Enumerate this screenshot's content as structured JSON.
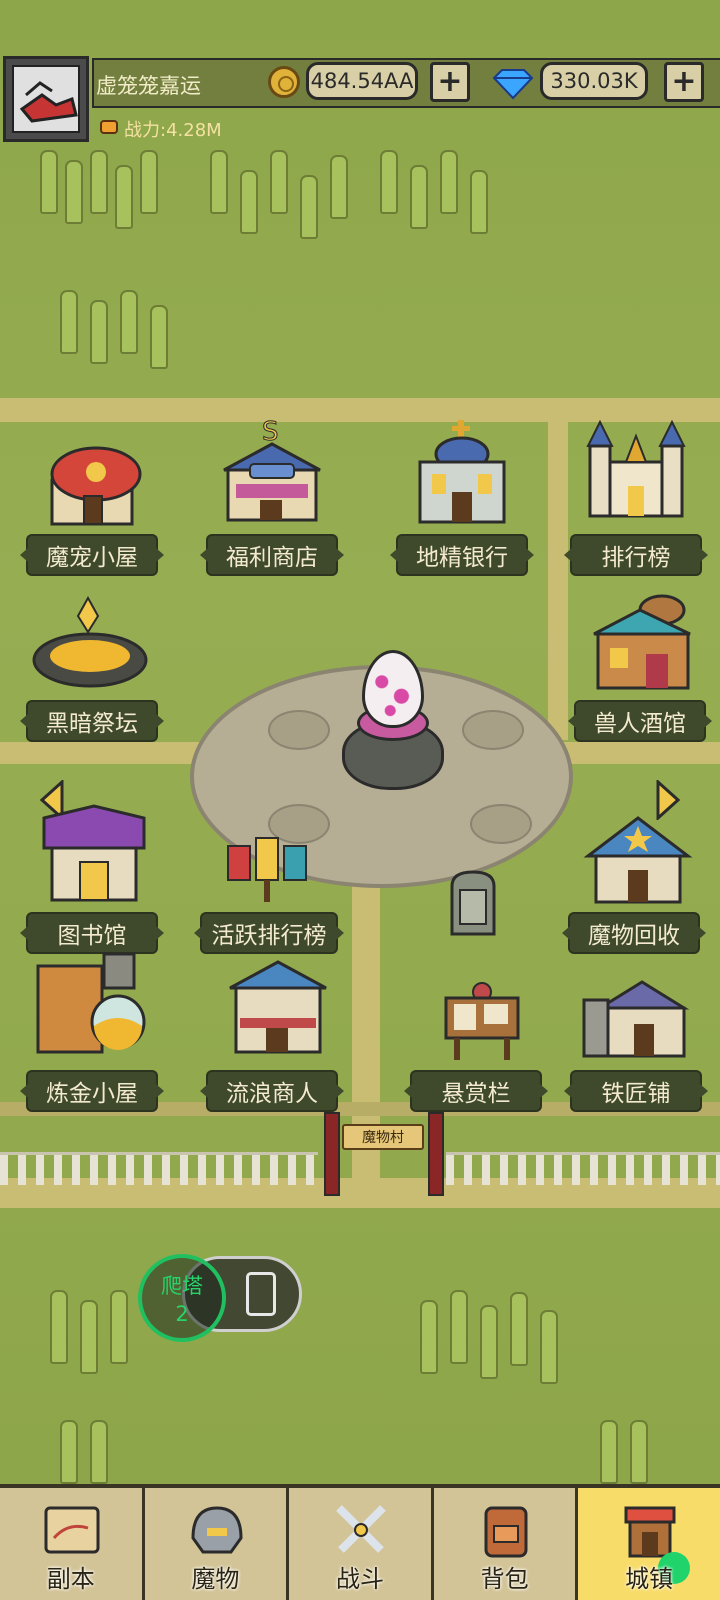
{
  "player": {
    "name": "虚笼笼嘉运",
    "power_label": "战力:4.28M"
  },
  "currency": {
    "gold": "484.54AA",
    "diamond": "330.03K",
    "add_symbol": "+"
  },
  "buildings": [
    {
      "key": "pet-house",
      "label": "魔宠小屋"
    },
    {
      "key": "welfare-shop",
      "label": "福利商店"
    },
    {
      "key": "goblin-bank",
      "label": "地精银行"
    },
    {
      "key": "leaderboard",
      "label": "排行榜"
    },
    {
      "key": "dark-altar",
      "label": "黑暗祭坛"
    },
    {
      "key": "orc-tavern",
      "label": "兽人酒馆"
    },
    {
      "key": "library",
      "label": "图书馆"
    },
    {
      "key": "active-ranking",
      "label": "活跃排行榜"
    },
    {
      "key": "monster-recycle",
      "label": "魔物回收"
    },
    {
      "key": "alchemy-house",
      "label": "炼金小屋"
    },
    {
      "key": "wandering-merchant",
      "label": "流浪商人"
    },
    {
      "key": "bounty-board",
      "label": "悬赏栏"
    },
    {
      "key": "blacksmith",
      "label": "铁匠铺"
    }
  ],
  "gate": {
    "sign": "魔物村"
  },
  "tower": {
    "label": "爬塔",
    "level": "2"
  },
  "nav": {
    "tabs": [
      {
        "label": "副本",
        "icon": "map-icon"
      },
      {
        "label": "魔物",
        "icon": "helmet-icon"
      },
      {
        "label": "战斗",
        "icon": "crossed-swords-icon"
      },
      {
        "label": "背包",
        "icon": "backpack-icon"
      },
      {
        "label": "城镇",
        "icon": "town-shop-icon",
        "active": true
      }
    ]
  },
  "colors": {
    "label_bg": "#3f4a2c",
    "active_tab": "#f8dc6a",
    "accent_green": "#20c060"
  }
}
